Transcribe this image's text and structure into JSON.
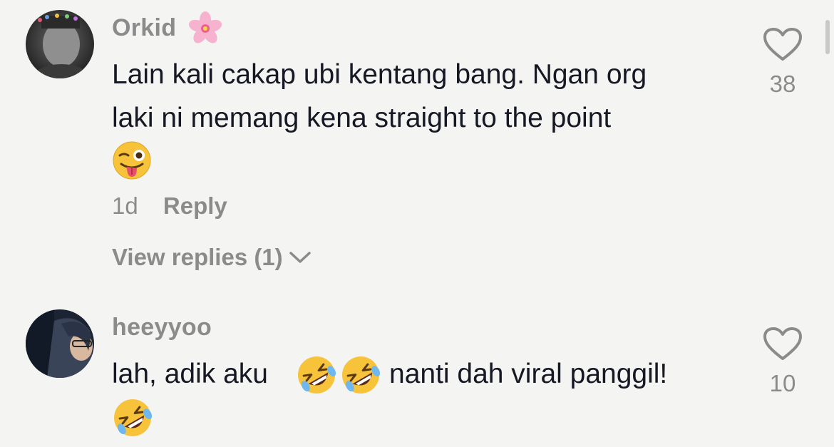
{
  "comments": [
    {
      "username": "Orkid",
      "name_emoji": "cherry-blossom",
      "text_line1": "Lain kali cakap ubi kentang bang. Ngan org",
      "text_line2": "laki ni memang kena straight to the point",
      "trailing_emoji": "winking-face-with-tongue",
      "date": "1d",
      "reply_label": "Reply",
      "view_replies_label": "View replies (1)",
      "likes": "38"
    },
    {
      "username": "heeyyoo",
      "text_before_emoji": "lah, adik aku",
      "inline_emojis": [
        "rolling-on-floor-laughing",
        "rolling-on-floor-laughing"
      ],
      "text_after_emoji": "nanti dah viral panggil!",
      "trailing_emoji": "rolling-on-floor-laughing",
      "likes": "10"
    }
  ],
  "colors": {
    "background": "#f4f4f3",
    "text": "#161823",
    "secondary": "#8b8b8b"
  }
}
